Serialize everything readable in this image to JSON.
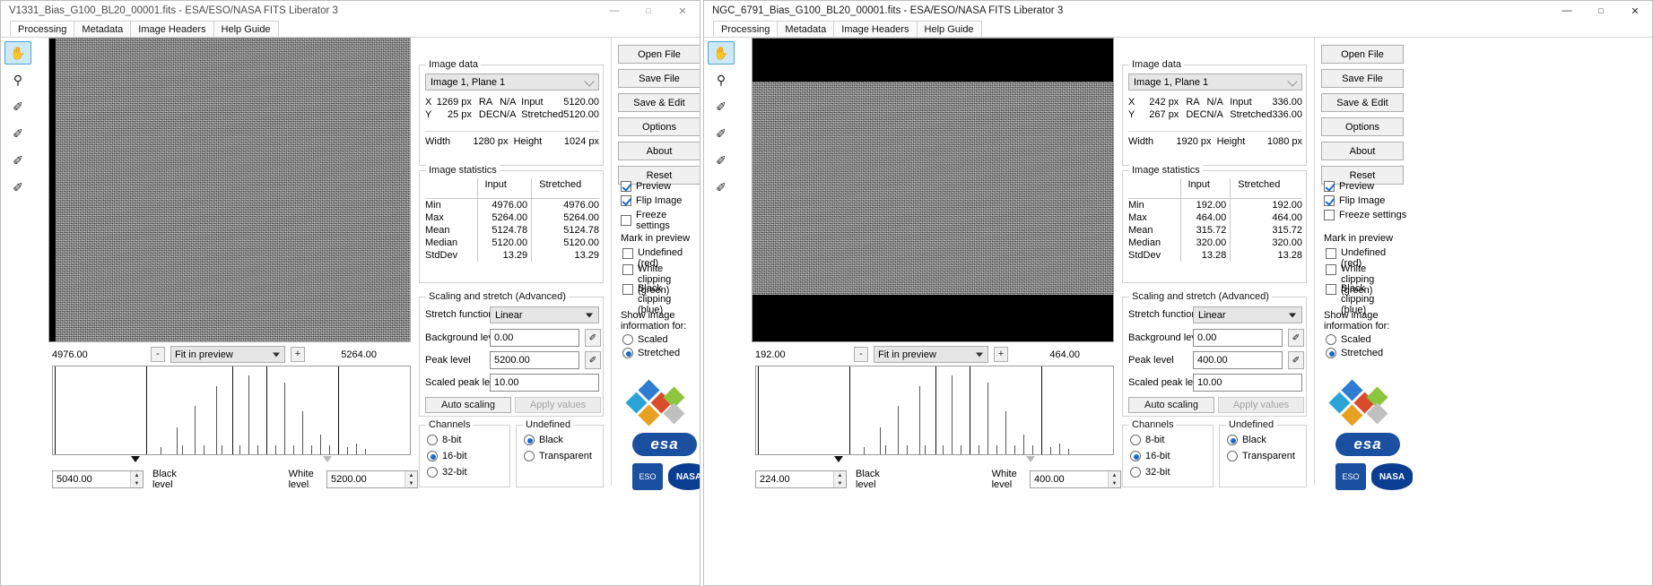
{
  "windows": [
    {
      "id": "left",
      "title": "V1331_Bias_G100_BL20_00001.fits - ESA/ESO/NASA FITS Liberator 3",
      "controls": {
        "minimize": "—",
        "maximize": "□",
        "close": "✕"
      },
      "tabs": [
        {
          "label": "Processing",
          "active": true
        },
        {
          "label": "Metadata",
          "active": false
        },
        {
          "label": "Image Headers",
          "active": false
        },
        {
          "label": "Help Guide",
          "active": false
        }
      ],
      "tools": [
        {
          "name": "pan-hand-tool",
          "glyph": "✋",
          "selected": true
        },
        {
          "name": "zoom-magnifier-tool",
          "glyph": "⚲",
          "selected": false
        },
        {
          "name": "eyedropper-tool",
          "glyph": "✐",
          "selected": false
        },
        {
          "name": "eyedropper-white-tool",
          "glyph": "✐",
          "selected": false
        },
        {
          "name": "eyedropper-black-point-tool",
          "glyph": "✐",
          "selected": false
        },
        {
          "name": "eyedropper-white-point-tool",
          "glyph": "✐",
          "selected": false
        }
      ],
      "zoombar": {
        "min_label": "4976.00",
        "max_label": "5264.00",
        "minus": "-",
        "plus": "+",
        "zoom_value": "Fit in preview"
      },
      "levels": {
        "black_value": "5040.00",
        "black_label": "Black level",
        "white_label": "White level",
        "white_value": "5200.00"
      },
      "image_data": {
        "caption": "Image data",
        "plane": "Image 1, Plane 1",
        "x_label": "X",
        "x_value": "1269 px",
        "ra_label": "RA",
        "ra_value": "N/A",
        "input_label": "Input",
        "input_value": "5120.00",
        "y_label": "Y",
        "y_value": "25 px",
        "dec_label": "DEC",
        "dec_value": "N/A",
        "stretched_label": "Stretched",
        "stretched_value": "5120.00",
        "width_label": "Width",
        "width_value": "1280 px",
        "height_label": "Height",
        "height_value": "1024 px"
      },
      "image_statistics": {
        "caption": "Image statistics",
        "col_input": "Input",
        "col_stretched": "Stretched",
        "rows": [
          {
            "label": "Min",
            "input": "4976.00",
            "stretched": "4976.00"
          },
          {
            "label": "Max",
            "input": "5264.00",
            "stretched": "5264.00"
          },
          {
            "label": "Mean",
            "input": "5124.78",
            "stretched": "5124.78"
          },
          {
            "label": "Median",
            "input": "5120.00",
            "stretched": "5120.00"
          },
          {
            "label": "StdDev",
            "input": "13.29",
            "stretched": "13.29"
          }
        ]
      },
      "scaling": {
        "caption": "Scaling and stretch (Advanced)",
        "stretch_label": "Stretch function",
        "stretch_value": "Linear",
        "background_label": "Background level",
        "background_value": "0.00",
        "peak_label": "Peak level",
        "peak_value": "5200.00",
        "scaled_peak_label": "Scaled peak level",
        "scaled_peak_value": "10.00",
        "auto_scaling": "Auto scaling",
        "apply_values": "Apply values"
      },
      "channels": {
        "caption": "Channels",
        "options": [
          {
            "label": "8-bit",
            "selected": false
          },
          {
            "label": "16-bit",
            "selected": true
          },
          {
            "label": "32-bit",
            "selected": false
          }
        ]
      },
      "undefined_grp": {
        "caption": "Undefined",
        "options": [
          {
            "label": "Black",
            "selected": true
          },
          {
            "label": "Transparent",
            "selected": false
          }
        ]
      },
      "buttons": [
        {
          "label": "Open File"
        },
        {
          "label": "Save File"
        },
        {
          "label": "Save & Edit"
        },
        {
          "label": "Options"
        },
        {
          "label": "About"
        },
        {
          "label": "Reset"
        }
      ],
      "preview_checks": [
        {
          "label": "Preview",
          "checked": true
        },
        {
          "label": "Flip Image",
          "checked": true
        },
        {
          "label": "Freeze settings",
          "checked": false
        }
      ],
      "mark_in_preview": {
        "caption": "Mark in preview",
        "options": [
          {
            "label": "Undefined (red)",
            "checked": false
          },
          {
            "label": "White clipping (green)",
            "checked": false
          },
          {
            "label": "Black clipping (blue)",
            "checked": false
          }
        ]
      },
      "show_info": {
        "caption": "Show image information for:",
        "options": [
          {
            "label": "Scaled",
            "selected": false
          },
          {
            "label": "Stretched",
            "selected": true
          }
        ]
      },
      "logos": {
        "esa": "esa",
        "eso": "ESO",
        "nasa": "NASA"
      }
    },
    {
      "id": "right",
      "title": "NGC_6791_Bias_G100_BL20_00001.fits - ESA/ESO/NASA FITS Liberator 3",
      "controls": {
        "minimize": "—",
        "maximize": "□",
        "close": "✕"
      },
      "tabs": [
        {
          "label": "Processing",
          "active": true
        },
        {
          "label": "Metadata",
          "active": false
        },
        {
          "label": "Image Headers",
          "active": false
        },
        {
          "label": "Help Guide",
          "active": false
        }
      ],
      "tools": [
        {
          "name": "pan-hand-tool",
          "glyph": "✋",
          "selected": true
        },
        {
          "name": "zoom-magnifier-tool",
          "glyph": "⚲",
          "selected": false
        },
        {
          "name": "eyedropper-tool",
          "glyph": "✐",
          "selected": false
        },
        {
          "name": "eyedropper-white-tool",
          "glyph": "✐",
          "selected": false
        },
        {
          "name": "eyedropper-black-point-tool",
          "glyph": "✐",
          "selected": false
        },
        {
          "name": "eyedropper-white-point-tool",
          "glyph": "✐",
          "selected": false
        }
      ],
      "zoombar": {
        "min_label": "192.00",
        "max_label": "464.00",
        "minus": "-",
        "plus": "+",
        "zoom_value": "Fit in preview"
      },
      "levels": {
        "black_value": "224.00",
        "black_label": "Black level",
        "white_label": "White level",
        "white_value": "400.00"
      },
      "image_data": {
        "caption": "Image data",
        "plane": "Image 1, Plane 1",
        "x_label": "X",
        "x_value": "242 px",
        "ra_label": "RA",
        "ra_value": "N/A",
        "input_label": "Input",
        "input_value": "336.00",
        "y_label": "Y",
        "y_value": "267 px",
        "dec_label": "DEC",
        "dec_value": "N/A",
        "stretched_label": "Stretched",
        "stretched_value": "336.00",
        "width_label": "Width",
        "width_value": "1920 px",
        "height_label": "Height",
        "height_value": "1080 px"
      },
      "image_statistics": {
        "caption": "Image statistics",
        "col_input": "Input",
        "col_stretched": "Stretched",
        "rows": [
          {
            "label": "Min",
            "input": "192.00",
            "stretched": "192.00"
          },
          {
            "label": "Max",
            "input": "464.00",
            "stretched": "464.00"
          },
          {
            "label": "Mean",
            "input": "315.72",
            "stretched": "315.72"
          },
          {
            "label": "Median",
            "input": "320.00",
            "stretched": "320.00"
          },
          {
            "label": "StdDev",
            "input": "13.28",
            "stretched": "13.28"
          }
        ]
      },
      "scaling": {
        "caption": "Scaling and stretch (Advanced)",
        "stretch_label": "Stretch function",
        "stretch_value": "Linear",
        "background_label": "Background level",
        "background_value": "0.00",
        "peak_label": "Peak level",
        "peak_value": "400.00",
        "scaled_peak_label": "Scaled peak level",
        "scaled_peak_value": "10.00",
        "auto_scaling": "Auto scaling",
        "apply_values": "Apply values"
      },
      "channels": {
        "caption": "Channels",
        "options": [
          {
            "label": "8-bit",
            "selected": false
          },
          {
            "label": "16-bit",
            "selected": true
          },
          {
            "label": "32-bit",
            "selected": false
          }
        ]
      },
      "undefined_grp": {
        "caption": "Undefined",
        "options": [
          {
            "label": "Black",
            "selected": true
          },
          {
            "label": "Transparent",
            "selected": false
          }
        ]
      },
      "buttons": [
        {
          "label": "Open File"
        },
        {
          "label": "Save File"
        },
        {
          "label": "Save & Edit"
        },
        {
          "label": "Options"
        },
        {
          "label": "About"
        },
        {
          "label": "Reset"
        }
      ],
      "preview_checks": [
        {
          "label": "Preview",
          "checked": true
        },
        {
          "label": "Flip Image",
          "checked": true
        },
        {
          "label": "Freeze settings",
          "checked": false
        }
      ],
      "mark_in_preview": {
        "caption": "Mark in preview",
        "options": [
          {
            "label": "Undefined (red)",
            "checked": false
          },
          {
            "label": "White clipping (green)",
            "checked": false
          },
          {
            "label": "Black clipping (blue)",
            "checked": false
          }
        ]
      },
      "show_info": {
        "caption": "Show image information for:",
        "options": [
          {
            "label": "Scaled",
            "selected": false
          },
          {
            "label": "Stretched",
            "selected": true
          }
        ]
      },
      "logos": {
        "esa": "esa",
        "eso": "ESO",
        "nasa": "NASA"
      }
    }
  ],
  "histograms": {
    "left": {
      "spikes": [
        0.0,
        26,
        0.88,
        35,
        0.1,
        48,
        0.48,
        58,
        0.12,
        67,
        0.8,
        77,
        0.12,
        86,
        0.95,
        97,
        0.1,
        100,
        0.65,
        0.0
      ]
    },
    "right": {
      "spikes": [
        0.0,
        26,
        0.88,
        35,
        0.1,
        48,
        0.48,
        58,
        0.12,
        67,
        0.8,
        77,
        0.12,
        86,
        0.95,
        97,
        0.1,
        100,
        0.65,
        0.0
      ]
    }
  },
  "colors": {
    "accent": "#1b6ac9",
    "window_bg": "#f0f0f0",
    "panel_border": "#d0d0d0",
    "esa_blue": "#1b4fa0",
    "nasa_blue": "#0b3d91"
  }
}
